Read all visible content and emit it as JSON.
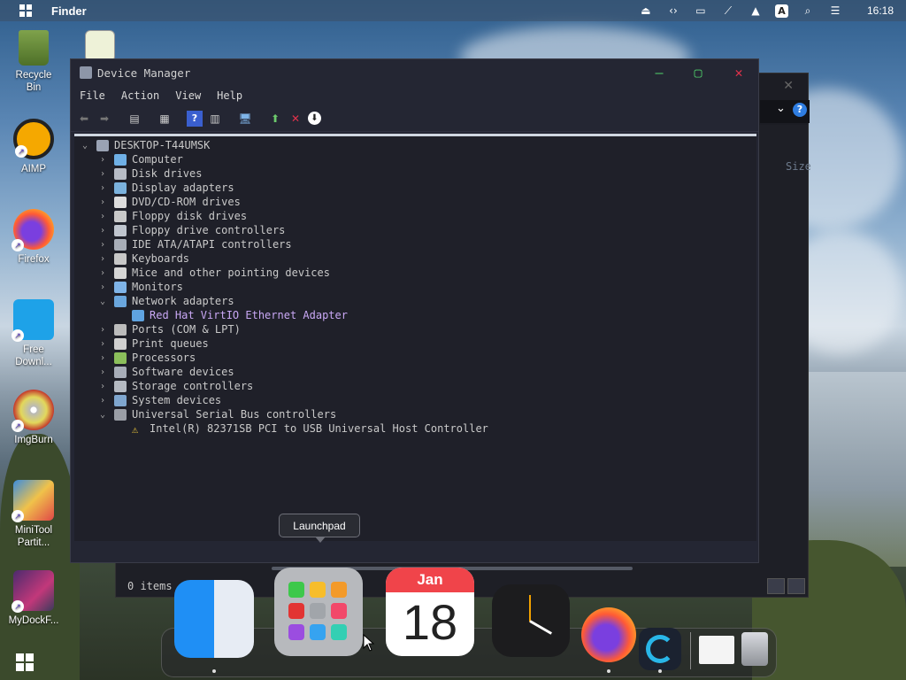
{
  "menubar": {
    "app_name": "Finder",
    "clock": "16:18",
    "tray_icons": [
      "eject-icon",
      "remote-icon",
      "display-icon",
      "network-off-icon",
      "upload-icon",
      "input-method-icon",
      "search-icon",
      "control-center-icon"
    ],
    "input_method_label": "A"
  },
  "desktop_icons": [
    {
      "label": "Recycle\nBin",
      "icon": "recycle-bin-icon"
    },
    {
      "label": "AIMP",
      "icon": "aimp-icon"
    },
    {
      "label": "Firefox",
      "icon": "firefox-icon"
    },
    {
      "label": "Free\nDownl...",
      "icon": "free-download-icon"
    },
    {
      "label": "ImgBurn",
      "icon": "imgburn-icon"
    },
    {
      "label": "MiniTool\nPartit...",
      "icon": "minitool-icon"
    },
    {
      "label": "MyDockF...",
      "icon": "mydock-icon"
    }
  ],
  "device_manager": {
    "title": "Device Manager",
    "menus": [
      "File",
      "Action",
      "View",
      "Help"
    ],
    "root": "DESKTOP-T44UMSK",
    "nodes": [
      {
        "label": "Computer",
        "expanded": false
      },
      {
        "label": "Disk drives",
        "expanded": false
      },
      {
        "label": "Display adapters",
        "expanded": false
      },
      {
        "label": "DVD/CD-ROM drives",
        "expanded": false
      },
      {
        "label": "Floppy disk drives",
        "expanded": false
      },
      {
        "label": "Floppy drive controllers",
        "expanded": false
      },
      {
        "label": "IDE ATA/ATAPI controllers",
        "expanded": false
      },
      {
        "label": "Keyboards",
        "expanded": false
      },
      {
        "label": "Mice and other pointing devices",
        "expanded": false
      },
      {
        "label": "Monitors",
        "expanded": false
      },
      {
        "label": "Network adapters",
        "expanded": true
      },
      {
        "label": "Red Hat VirtIO Ethernet Adapter",
        "child": true
      },
      {
        "label": "Ports (COM & LPT)",
        "expanded": false
      },
      {
        "label": "Print queues",
        "expanded": false
      },
      {
        "label": "Processors",
        "expanded": false
      },
      {
        "label": "Software devices",
        "expanded": false
      },
      {
        "label": "Storage controllers",
        "expanded": false
      },
      {
        "label": "System devices",
        "expanded": false
      },
      {
        "label": "Universal Serial Bus controllers",
        "expanded": true
      },
      {
        "label": "Intel(R) 82371SB PCI to USB Universal Host Controller",
        "child": true,
        "warning": true
      }
    ]
  },
  "finder_window": {
    "items_count": "0 items",
    "column_size": "Size"
  },
  "tooltip": "Launchpad",
  "dock": {
    "calendar_month": "Jan",
    "calendar_day": "18",
    "apps": [
      "finder-icon",
      "launchpad-icon",
      "calendar-icon",
      "clock-icon",
      "firefox-icon",
      "dev-tool-icon",
      "preview-icon",
      "trash-icon"
    ]
  },
  "colors": {
    "accent": "#2f7de1",
    "child_text": "#c9a8f5",
    "warning": "#e8c23a",
    "close_red": "#e0324b"
  }
}
